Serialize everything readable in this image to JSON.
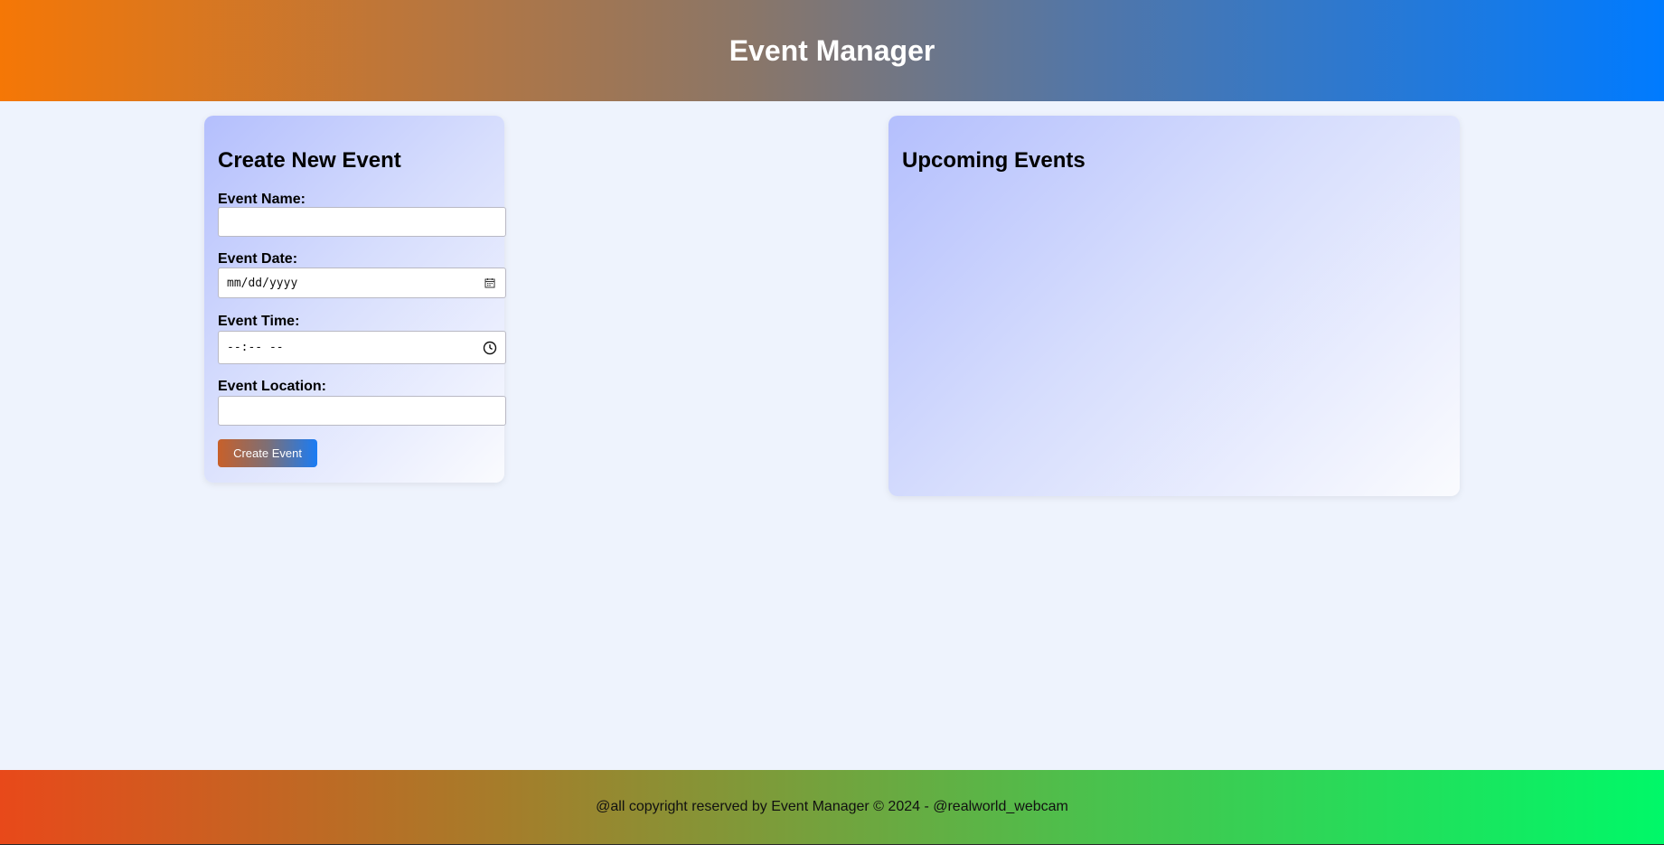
{
  "header": {
    "title": "Event Manager"
  },
  "form": {
    "heading": "Create New Event",
    "name_label": "Event Name:",
    "name_value": "",
    "date_label": "Event Date:",
    "date_placeholder": "mm/dd/yyyy",
    "time_label": "Event Time:",
    "time_placeholder": "--:-- --",
    "location_label": "Event Location:",
    "location_value": "",
    "submit_label": "Create Event"
  },
  "events": {
    "heading": "Upcoming Events",
    "items": []
  },
  "footer": {
    "text": "@all copyright reserved by Event Manager © 2024 - @realworld_webcam"
  },
  "colors": {
    "header_gradient_start": "#f57706",
    "header_gradient_end": "#007bff",
    "footer_gradient_start": "#e8491a",
    "footer_gradient_end": "#00f868",
    "page_background": "#eef3fd"
  },
  "icons": {
    "date": "calendar-icon",
    "time": "clock-icon"
  }
}
